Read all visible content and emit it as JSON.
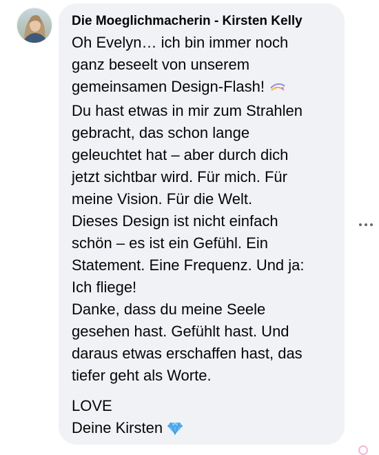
{
  "comment": {
    "author": "Die Moeglichmacherin - Kirsten Kelly",
    "avatar_icon": "profile-photo",
    "paragraph1": [
      "Oh Evelyn… ich bin immer noch",
      "ganz beseelt von unserem",
      "gemeinsamen Design-Flash!",
      "Du hast etwas in mir zum Strahlen",
      "gebracht, das schon lange",
      "geleuchtet hat – aber durch dich",
      "jetzt sichtbar wird. Für mich. Für",
      "meine Vision. Für die Welt.",
      "Dieses Design ist nicht einfach",
      "schön – es ist ein Gefühl. Ein",
      "Statement. Eine Frequenz. Und ja:",
      "Ich fliege!",
      "Danke, dass du meine Seele",
      "gesehen hast. Gefühlt hast. Und",
      "daraus etwas erschaffen hast, das",
      "tiefer geht als Worte."
    ],
    "closing": [
      "LOVE",
      "Deine Kirsten"
    ],
    "emoji_after_line3": "sparkles-icon",
    "emoji_after_signature": "gem-stone-icon",
    "colors": {
      "bubble": "#f0f2f5",
      "text": "#050505",
      "secondary": "#65676b"
    }
  },
  "actions": {
    "more_icon": "more-options-icon"
  }
}
